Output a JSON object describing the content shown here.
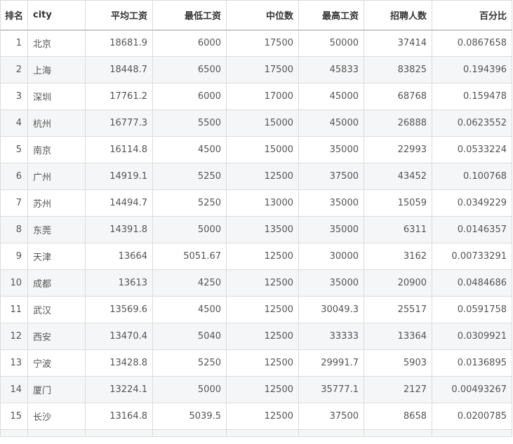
{
  "table": {
    "headers": [
      "排名",
      "city",
      "平均工资",
      "最低工资",
      "中位数",
      "最高工资",
      "招聘人数",
      "百分比"
    ],
    "rows": [
      [
        "1",
        "北京",
        "18681.9",
        "6000",
        "17500",
        "50000",
        "37414",
        "0.0867658"
      ],
      [
        "2",
        "上海",
        "18448.7",
        "6500",
        "17500",
        "45833",
        "83825",
        "0.194396"
      ],
      [
        "3",
        "深圳",
        "17761.2",
        "6000",
        "17000",
        "45000",
        "68768",
        "0.159478"
      ],
      [
        "4",
        "杭州",
        "16777.3",
        "5500",
        "15000",
        "45000",
        "26888",
        "0.0623552"
      ],
      [
        "5",
        "南京",
        "16114.8",
        "4500",
        "15000",
        "35000",
        "22993",
        "0.0533224"
      ],
      [
        "6",
        "广州",
        "14919.1",
        "5250",
        "12500",
        "37500",
        "43452",
        "0.100768"
      ],
      [
        "7",
        "苏州",
        "14494.7",
        "5250",
        "13000",
        "35000",
        "15059",
        "0.0349229"
      ],
      [
        "8",
        "东莞",
        "14391.8",
        "5000",
        "13500",
        "35000",
        "6311",
        "0.0146357"
      ],
      [
        "9",
        "天津",
        "13664",
        "5051.67",
        "12500",
        "30000",
        "3162",
        "0.00733291"
      ],
      [
        "10",
        "成都",
        "13613",
        "4250",
        "12500",
        "35000",
        "20900",
        "0.0484686"
      ],
      [
        "11",
        "武汉",
        "13569.6",
        "4500",
        "12500",
        "30049.3",
        "25517",
        "0.0591758"
      ],
      [
        "12",
        "西安",
        "13470.4",
        "5040",
        "12500",
        "33333",
        "13364",
        "0.0309921"
      ],
      [
        "13",
        "宁波",
        "13428.8",
        "5250",
        "12500",
        "29991.7",
        "5903",
        "0.0136895"
      ],
      [
        "14",
        "厦门",
        "13224.1",
        "5000",
        "12500",
        "35777.1",
        "2127",
        "0.00493267"
      ],
      [
        "15",
        "长沙",
        "13164.8",
        "5039.5",
        "12500",
        "37500",
        "8658",
        "0.0200785"
      ]
    ]
  }
}
